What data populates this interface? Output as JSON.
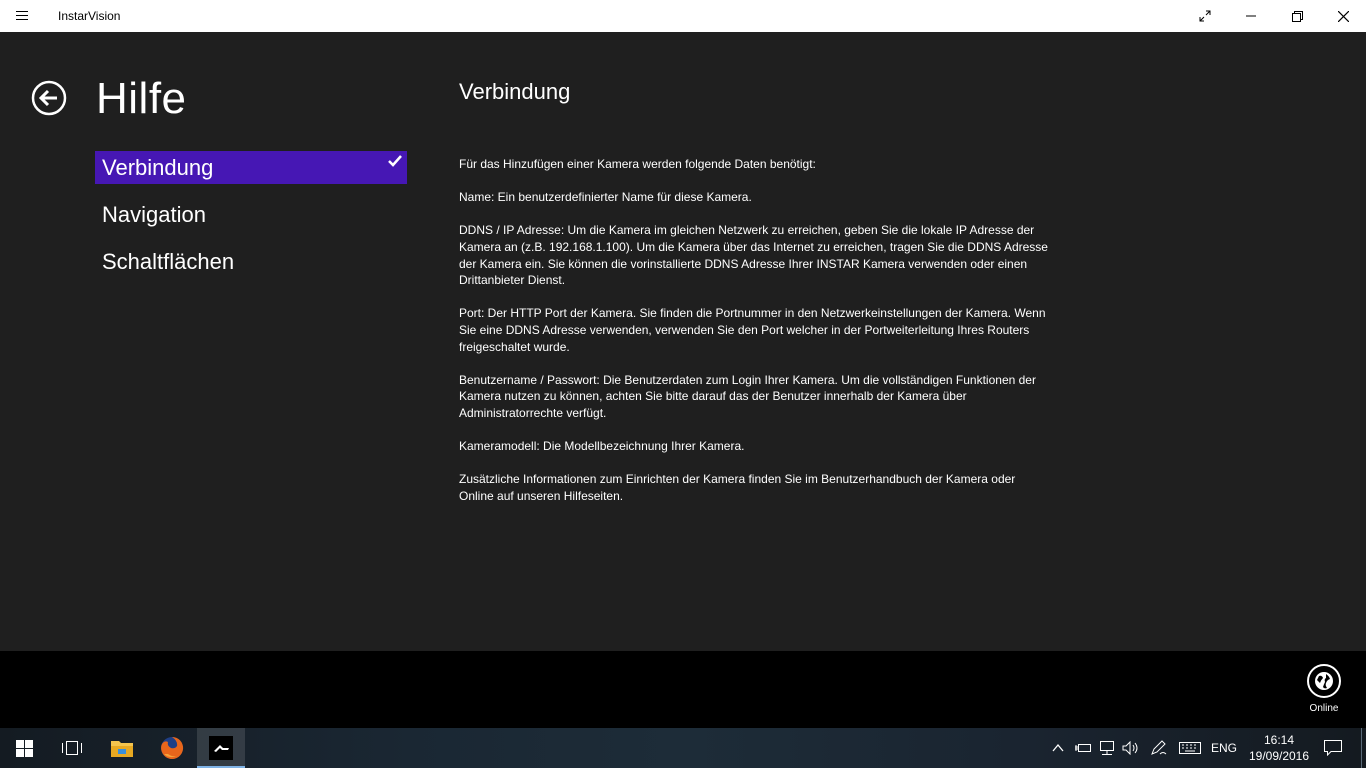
{
  "window": {
    "title": "InstarVision"
  },
  "page": {
    "title": "Hilfe"
  },
  "nav": {
    "items": [
      {
        "label": "Verbindung",
        "active": true
      },
      {
        "label": "Navigation",
        "active": false
      },
      {
        "label": "Schaltflächen",
        "active": false
      }
    ]
  },
  "content": {
    "title": "Verbindung",
    "paragraphs": [
      "Für das Hinzufügen einer Kamera werden folgende Daten benötigt:",
      "Name: Ein benutzerdefinierter Name für diese Kamera.",
      "DDNS / IP Adresse: Um die Kamera im gleichen Netzwerk zu erreichen, geben Sie die lokale IP Adresse der Kamera an (z.B. 192.168.1.100). Um die Kamera über das Internet zu erreichen, tragen Sie die DDNS Adresse der Kamera ein. Sie können die vorinstallierte DDNS Adresse Ihrer INSTAR Kamera verwenden oder einen Drittanbieter Dienst.",
      "Port: Der HTTP Port der Kamera. Sie finden die Portnummer in den Netzwerkeinstellungen der Kamera. Wenn Sie eine DDNS Adresse verwenden, verwenden Sie den Port welcher in der Portweiterleitung Ihres Routers freigeschaltet wurde.",
      "Benutzername / Passwort: Die Benutzerdaten zum Login Ihrer Kamera. Um die vollständigen Funktionen der Kamera nutzen zu können, achten Sie bitte darauf das der Benutzer innerhalb der Kamera über Administratorrechte verfügt.",
      "Kameramodell: Die Modellbezeichnung Ihrer Kamera.",
      "Zusätzliche Informationen zum Einrichten der Kamera finden Sie im Benutzerhandbuch der Kamera oder Online auf unseren Hilfeseiten."
    ]
  },
  "appbar": {
    "online_label": "Online"
  },
  "taskbar": {
    "language": "ENG",
    "time": "16:14",
    "date": "19/09/2016"
  },
  "colors": {
    "accent": "#4617b4",
    "background": "#1f1f1f",
    "appbar": "#000000"
  }
}
